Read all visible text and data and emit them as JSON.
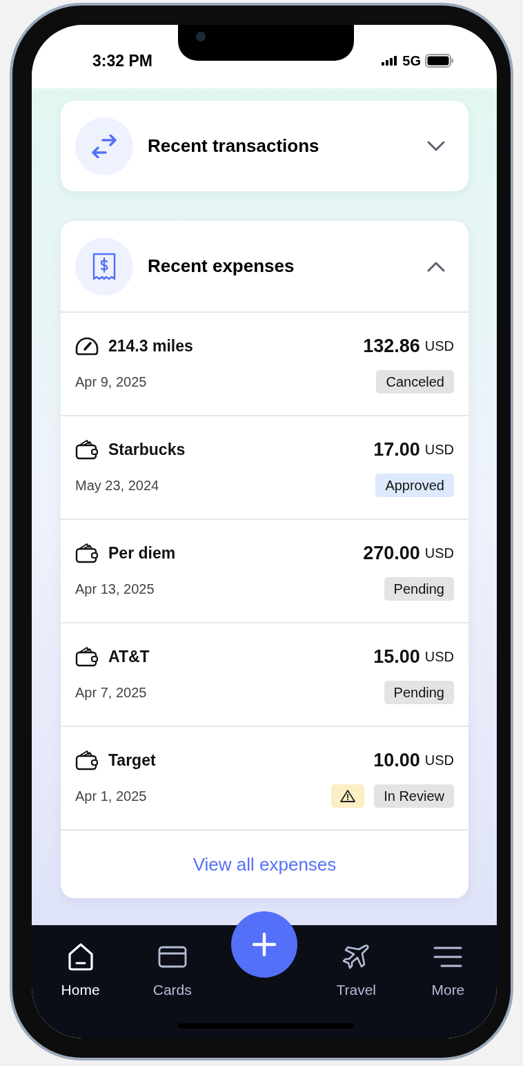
{
  "status_bar": {
    "time": "3:32 PM",
    "network": "5G"
  },
  "sections": [
    {
      "title": "Recent transactions",
      "kind": "transfer",
      "expanded": false
    },
    {
      "title": "Recent expenses",
      "kind": "receipt",
      "expanded": true,
      "items": [
        {
          "kind": "mileage",
          "name": "214.3 miles",
          "amount": "132.86",
          "currency": "USD",
          "date": "Apr 9, 2025",
          "status": "Canceled",
          "color": "#e3e3e5",
          "warning": false
        },
        {
          "kind": "wallet",
          "name": "Starbucks",
          "amount": "17.00",
          "currency": "USD",
          "date": "May 23, 2024",
          "status": "Approved",
          "color": "#dde9fc",
          "warning": false
        },
        {
          "kind": "wallet",
          "name": "Per diem",
          "amount": "270.00",
          "currency": "USD",
          "date": "Apr 13, 2025",
          "status": "Pending",
          "color": "#e3e3e5",
          "warning": false
        },
        {
          "kind": "wallet",
          "name": "AT&T",
          "amount": "15.00",
          "currency": "USD",
          "date": "Apr 7, 2025",
          "status": "Pending",
          "color": "#e3e3e5",
          "warning": false
        },
        {
          "kind": "wallet",
          "name": "Target",
          "amount": "10.00",
          "currency": "USD",
          "date": "Apr 1, 2025",
          "status": "In Review",
          "color": "#e3e3e5",
          "warning": true
        }
      ],
      "link": "View all expenses"
    }
  ],
  "nav": [
    {
      "label": "Home",
      "kind": "home",
      "selected": true
    },
    {
      "label": "Cards",
      "kind": "card",
      "selected": false
    },
    {
      "label": "Travel",
      "kind": "plane",
      "selected": false
    },
    {
      "label": "More",
      "kind": "menu",
      "selected": false
    }
  ]
}
